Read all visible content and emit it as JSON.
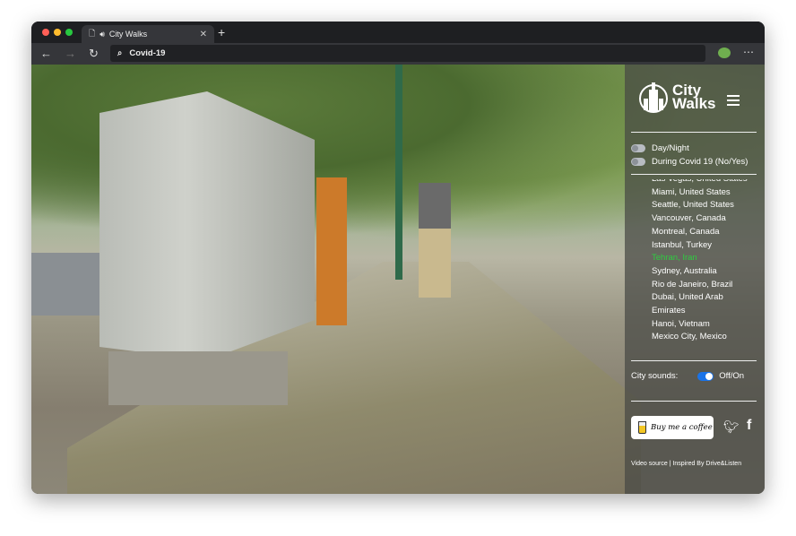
{
  "browser": {
    "tab_title": "City Walks",
    "address": "Covid-19",
    "icons": [
      "page-icon",
      "speaker-icon",
      "close-icon",
      "plus-icon",
      "back-icon",
      "forward-icon",
      "reload-icon",
      "search-icon",
      "extension-icon",
      "more-icon"
    ]
  },
  "sidebar": {
    "logo": {
      "line1": "City",
      "line2": "Walks"
    },
    "toggles": [
      {
        "label": "Day/Night",
        "on": false
      },
      {
        "label": "During Covid 19 (No/Yes)",
        "on": false
      }
    ],
    "cities": [
      "Las Vegas, United States",
      "Miami, United States",
      "Seattle, United States",
      "Vancouver, Canada",
      "Montreal, Canada",
      "Istanbul, Turkey",
      "Tehran, Iran",
      "Sydney, Australia",
      "Rio de Janeiro, Brazil",
      "Dubai, United Arab Emirates",
      "Hanoi, Vietnam",
      "Mexico City, Mexico"
    ],
    "active_city": "Tehran, Iran",
    "active_color": "#2ecc40",
    "sounds": {
      "label": "City sounds:",
      "state_label": "Off/On",
      "on": true
    },
    "coffee_label": "Buy me a coffee",
    "footer": {
      "video_source": "Video source",
      "inspired": "Inspired By Drive&Listen"
    }
  }
}
